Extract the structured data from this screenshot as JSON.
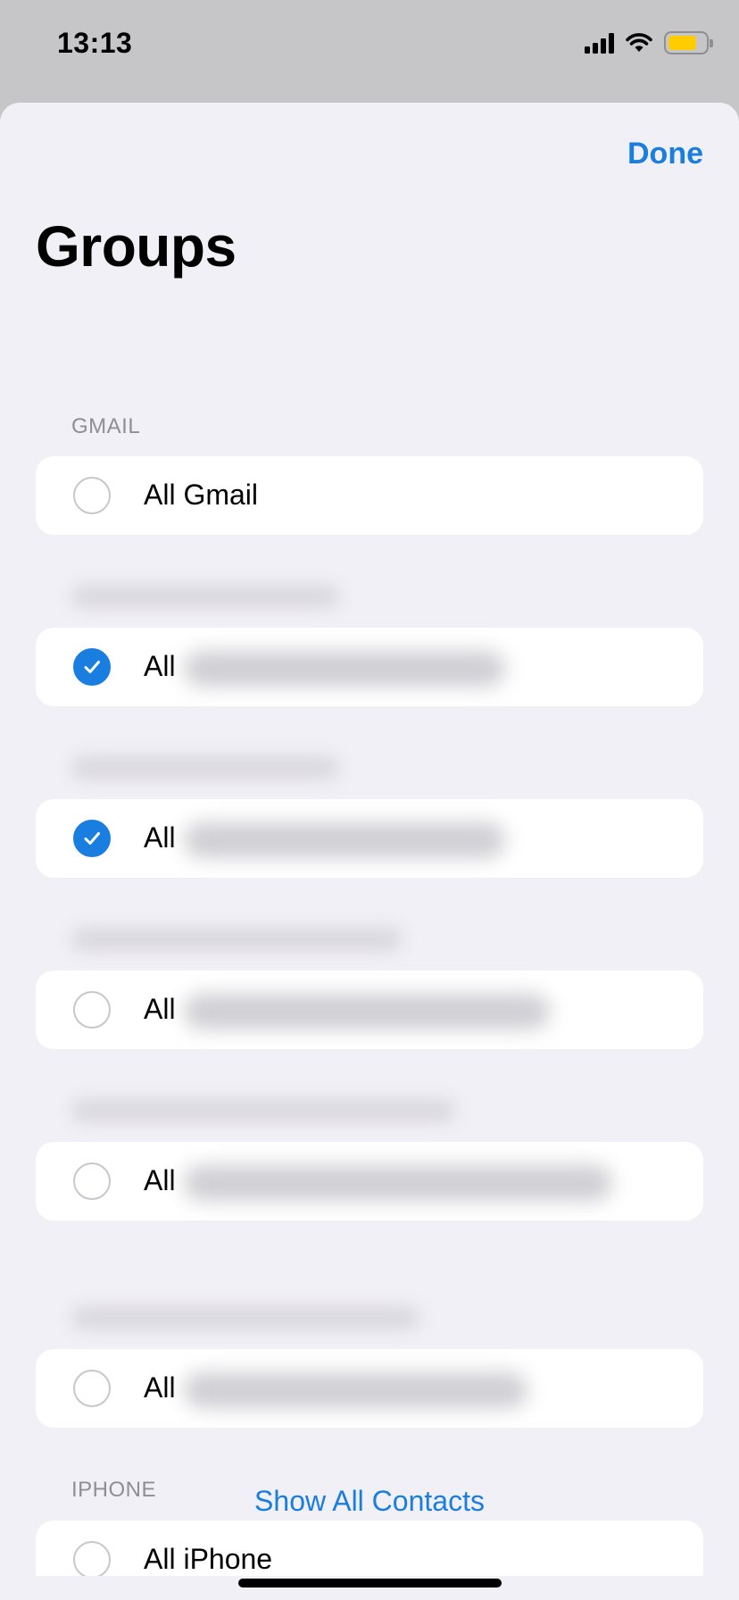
{
  "status_bar": {
    "time": "13:13",
    "battery_color": "#ffcc00"
  },
  "header": {
    "done_label": "Done",
    "title": "Groups"
  },
  "sections": [
    {
      "header": "GMAIL",
      "header_redacted": false,
      "row_prefix": "All Gmail",
      "checked": false,
      "redacted": false
    },
    {
      "header": "",
      "header_redacted": true,
      "row_prefix": "All",
      "checked": true,
      "redacted": true
    },
    {
      "header": "",
      "header_redacted": true,
      "row_prefix": "All",
      "checked": true,
      "redacted": true
    },
    {
      "header": "",
      "header_redacted": true,
      "row_prefix": "All",
      "checked": false,
      "redacted": true
    },
    {
      "header": "",
      "header_redacted": true,
      "row_prefix": "All",
      "checked": false,
      "redacted": true
    },
    {
      "header": "",
      "header_redacted": true,
      "row_prefix": "All",
      "checked": false,
      "redacted": true
    },
    {
      "header": "IPHONE",
      "header_redacted": false,
      "row_prefix": "All iPhone",
      "checked": false,
      "redacted": false
    }
  ],
  "footer": {
    "show_all_label": "Show All Contacts"
  },
  "colors": {
    "accent": "#1a7ee0",
    "sheet_bg": "#f1f0f6",
    "secondary_text": "#8e8e93"
  },
  "icons": [
    "signal-icon",
    "wifi-icon",
    "battery-icon",
    "checkmark-icon"
  ]
}
